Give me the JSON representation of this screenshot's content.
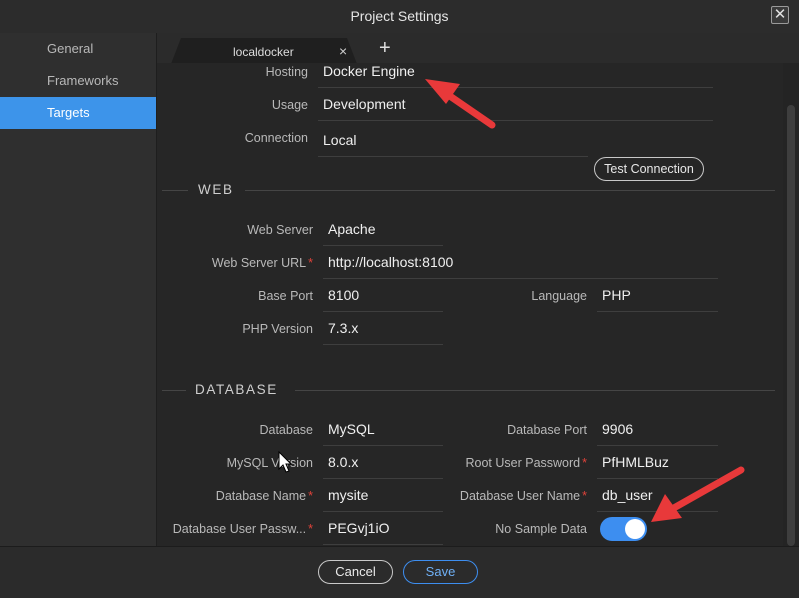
{
  "window": {
    "title": "Project Settings",
    "close_glyph": "✕"
  },
  "sidebar": {
    "items": [
      {
        "label": "General"
      },
      {
        "label": "Frameworks"
      },
      {
        "label": "Targets",
        "active": true
      }
    ]
  },
  "tabs": [
    {
      "label": "localdocker",
      "close_glyph": "×"
    }
  ],
  "tab_add_glyph": "+",
  "target": {
    "hosting_label": "Hosting",
    "hosting_value": "Docker Engine",
    "usage_label": "Usage",
    "usage_value": "Development",
    "connection_label": "Connection",
    "connection_value": "Local",
    "test_connection_label": "Test Connection"
  },
  "web": {
    "section_title": "WEB",
    "web_server_label": "Web Server",
    "web_server_value": "Apache",
    "web_server_url_label": "Web Server URL",
    "web_server_url_value": "http://localhost:8100",
    "base_port_label": "Base Port",
    "base_port_value": "8100",
    "language_label": "Language",
    "language_value": "PHP",
    "php_version_label": "PHP Version",
    "php_version_value": "7.3.x"
  },
  "database": {
    "section_title": "DATABASE",
    "database_label": "Database",
    "database_value": "MySQL",
    "port_label": "Database Port",
    "port_value": "9906",
    "mysql_version_label": "MySQL Version",
    "mysql_version_value": "8.0.x",
    "root_password_label": "Root User Password",
    "root_password_value": "PfHMLBuz",
    "db_name_label": "Database Name",
    "db_name_value": "mysite",
    "db_user_label": "Database User Name",
    "db_user_value": "db_user",
    "db_user_password_label": "Database User Passw...",
    "db_user_password_value": "PEGvj1iO",
    "no_sample_data_label": "No Sample Data",
    "no_sample_data_on": true
  },
  "required_mark": "*",
  "footer": {
    "cancel_label": "Cancel",
    "save_label": "Save"
  },
  "colors": {
    "accent": "#3d94ea",
    "required": "#e0423a",
    "annotation_arrow": "#e8393a"
  }
}
